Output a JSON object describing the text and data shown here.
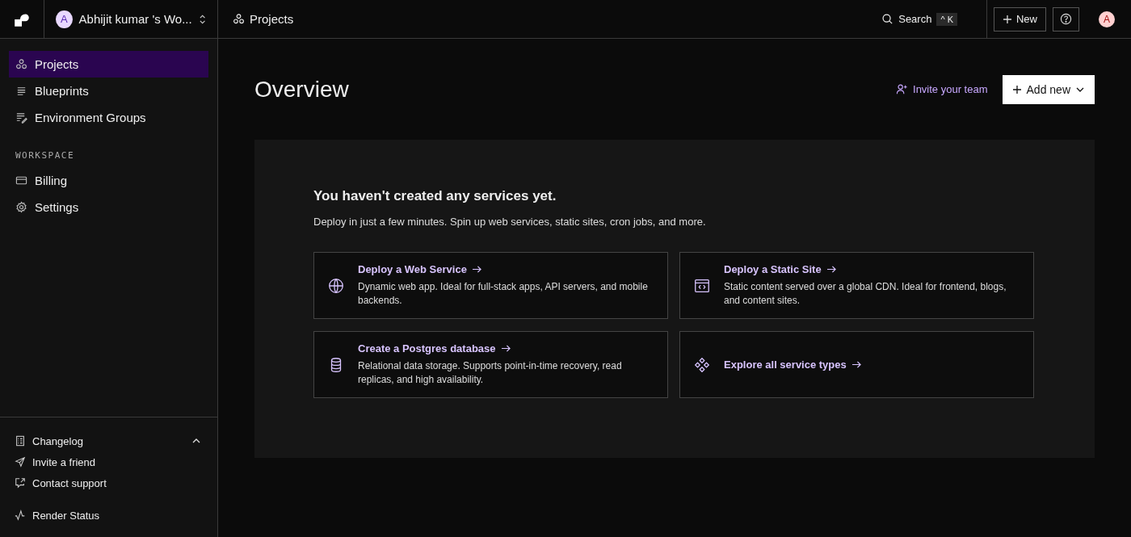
{
  "topbar": {
    "workspace": {
      "avatar": "A",
      "name": "Abhijit kumar 's Wo..."
    },
    "breadcrumb": "Projects",
    "search": {
      "label": "Search",
      "shortcut": "^ K"
    },
    "new_button": "New",
    "user_avatar": "A"
  },
  "sidebar": {
    "nav": [
      {
        "label": "Projects",
        "kind": "projects",
        "selected": true
      },
      {
        "label": "Blueprints",
        "kind": "blueprints",
        "selected": false
      },
      {
        "label": "Environment Groups",
        "kind": "envgroups",
        "selected": false
      }
    ],
    "section_title": "WORKSPACE",
    "workspace_items": [
      {
        "label": "Billing",
        "kind": "billing",
        "selected": false
      },
      {
        "label": "Settings",
        "kind": "settings",
        "selected": false
      }
    ],
    "changelog": {
      "label": "Changelog",
      "expanded": true
    },
    "footer_links": [
      {
        "label": "Invite a friend",
        "kind": "send"
      },
      {
        "label": "Contact support",
        "kind": "support"
      }
    ],
    "status_link": "Render Status"
  },
  "main": {
    "title": "Overview",
    "invite": "Invite your team",
    "add_new": "Add new",
    "empty": {
      "heading": "You haven't created any services yet.",
      "text": "Deploy in just a few minutes. Spin up web services, static sites, cron jobs, and more.",
      "cards": [
        {
          "kind": "globe",
          "title": "Deploy a Web Service",
          "description": "Dynamic web app. Ideal for full-stack apps, API servers, and mobile backends."
        },
        {
          "kind": "window",
          "title": "Deploy a Static Site",
          "description": "Static content served over a global CDN. Ideal for frontend, blogs, and content sites."
        },
        {
          "kind": "database",
          "title": "Create a Postgres database",
          "description": "Relational data storage. Supports point-in-time recovery, read replicas, and high availability."
        },
        {
          "kind": "grid",
          "title": "Explore all service types"
        }
      ]
    }
  }
}
